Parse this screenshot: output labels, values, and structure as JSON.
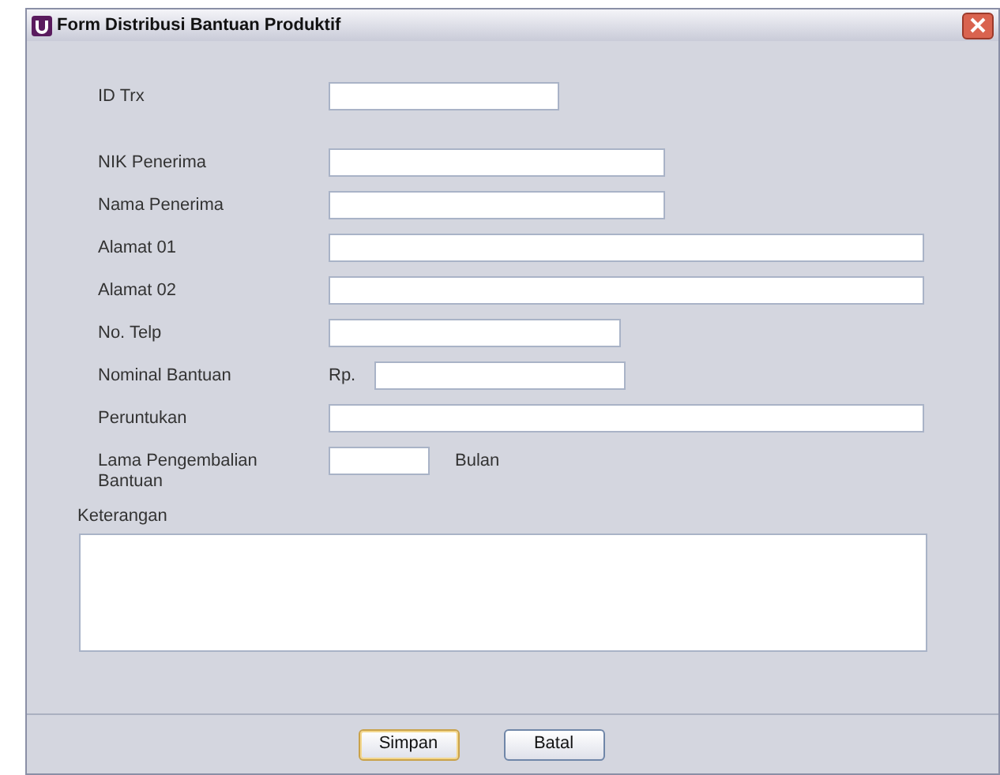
{
  "window": {
    "title": "Form Distribusi Bantuan Produktif"
  },
  "fields": [
    {
      "kind": "text",
      "label": "ID Trx"
    },
    {
      "kind": "text",
      "label": "NIK Penerima"
    },
    {
      "kind": "text",
      "label": "Nama Penerima"
    },
    {
      "kind": "text",
      "label": "Alamat 01"
    },
    {
      "kind": "text",
      "label": "Alamat 02"
    },
    {
      "kind": "text",
      "label": "No. Telp"
    },
    {
      "kind": "prefixed",
      "label": "Nominal Bantuan",
      "prefix": "Rp."
    },
    {
      "kind": "text",
      "label": "Peruntukan"
    },
    {
      "kind": "suffixed",
      "label": "Lama Pengembalian Bantuan",
      "suffix": "Bulan"
    }
  ],
  "notes": {
    "label": "Keterangan"
  },
  "buttons": [
    {
      "label": "Simpan",
      "selected": true
    },
    {
      "label": "Batal",
      "selected": false
    }
  ]
}
